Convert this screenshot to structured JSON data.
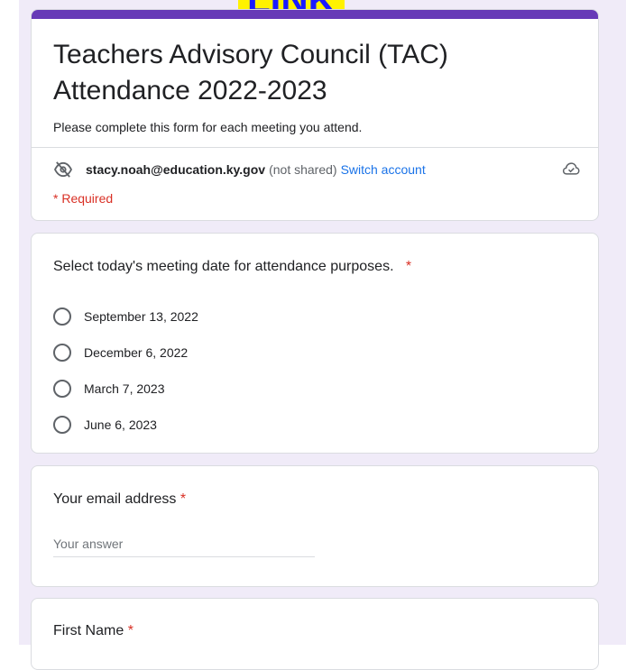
{
  "banner": {
    "text": "LINK"
  },
  "header": {
    "title": "Teachers Advisory Council (TAC) Attendance 2022-2023",
    "description": "Please complete this form for each meeting you attend.",
    "account_email": "stacy.noah@education.ky.gov",
    "account_shared": "(not shared)",
    "switch_account": "Switch account",
    "required_note": "* Required",
    "accent_color": "#673ab7",
    "eye_icon": "eye-off-icon",
    "cloud_icon": "cloud-done-icon"
  },
  "questions": [
    {
      "title": "Select today's meeting date for attendance purposes.",
      "required": "*",
      "options": [
        "September 13, 2022",
        "December 6, 2022",
        "March 7, 2023",
        "June 6, 2023"
      ]
    },
    {
      "title": "Your email address",
      "required": "*",
      "placeholder": "Your answer"
    },
    {
      "title": "First Name",
      "required": "*"
    }
  ]
}
